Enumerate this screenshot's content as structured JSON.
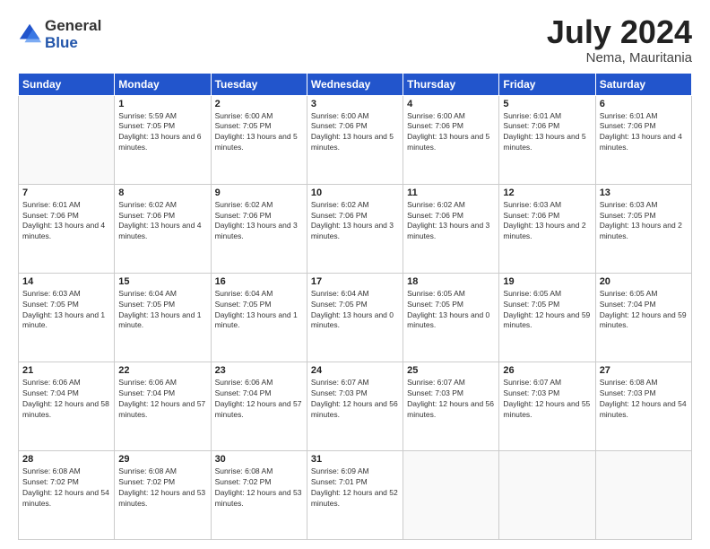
{
  "logo": {
    "general": "General",
    "blue": "Blue"
  },
  "title": {
    "month_year": "July 2024",
    "location": "Nema, Mauritania"
  },
  "header_days": [
    "Sunday",
    "Monday",
    "Tuesday",
    "Wednesday",
    "Thursday",
    "Friday",
    "Saturday"
  ],
  "weeks": [
    [
      {
        "day": "",
        "sunrise": "",
        "sunset": "",
        "daylight": ""
      },
      {
        "day": "1",
        "sunrise": "Sunrise: 5:59 AM",
        "sunset": "Sunset: 7:05 PM",
        "daylight": "Daylight: 13 hours and 6 minutes."
      },
      {
        "day": "2",
        "sunrise": "Sunrise: 6:00 AM",
        "sunset": "Sunset: 7:05 PM",
        "daylight": "Daylight: 13 hours and 5 minutes."
      },
      {
        "day": "3",
        "sunrise": "Sunrise: 6:00 AM",
        "sunset": "Sunset: 7:06 PM",
        "daylight": "Daylight: 13 hours and 5 minutes."
      },
      {
        "day": "4",
        "sunrise": "Sunrise: 6:00 AM",
        "sunset": "Sunset: 7:06 PM",
        "daylight": "Daylight: 13 hours and 5 minutes."
      },
      {
        "day": "5",
        "sunrise": "Sunrise: 6:01 AM",
        "sunset": "Sunset: 7:06 PM",
        "daylight": "Daylight: 13 hours and 5 minutes."
      },
      {
        "day": "6",
        "sunrise": "Sunrise: 6:01 AM",
        "sunset": "Sunset: 7:06 PM",
        "daylight": "Daylight: 13 hours and 4 minutes."
      }
    ],
    [
      {
        "day": "7",
        "sunrise": "Sunrise: 6:01 AM",
        "sunset": "Sunset: 7:06 PM",
        "daylight": "Daylight: 13 hours and 4 minutes."
      },
      {
        "day": "8",
        "sunrise": "Sunrise: 6:02 AM",
        "sunset": "Sunset: 7:06 PM",
        "daylight": "Daylight: 13 hours and 4 minutes."
      },
      {
        "day": "9",
        "sunrise": "Sunrise: 6:02 AM",
        "sunset": "Sunset: 7:06 PM",
        "daylight": "Daylight: 13 hours and 3 minutes."
      },
      {
        "day": "10",
        "sunrise": "Sunrise: 6:02 AM",
        "sunset": "Sunset: 7:06 PM",
        "daylight": "Daylight: 13 hours and 3 minutes."
      },
      {
        "day": "11",
        "sunrise": "Sunrise: 6:02 AM",
        "sunset": "Sunset: 7:06 PM",
        "daylight": "Daylight: 13 hours and 3 minutes."
      },
      {
        "day": "12",
        "sunrise": "Sunrise: 6:03 AM",
        "sunset": "Sunset: 7:06 PM",
        "daylight": "Daylight: 13 hours and 2 minutes."
      },
      {
        "day": "13",
        "sunrise": "Sunrise: 6:03 AM",
        "sunset": "Sunset: 7:05 PM",
        "daylight": "Daylight: 13 hours and 2 minutes."
      }
    ],
    [
      {
        "day": "14",
        "sunrise": "Sunrise: 6:03 AM",
        "sunset": "Sunset: 7:05 PM",
        "daylight": "Daylight: 13 hours and 1 minute."
      },
      {
        "day": "15",
        "sunrise": "Sunrise: 6:04 AM",
        "sunset": "Sunset: 7:05 PM",
        "daylight": "Daylight: 13 hours and 1 minute."
      },
      {
        "day": "16",
        "sunrise": "Sunrise: 6:04 AM",
        "sunset": "Sunset: 7:05 PM",
        "daylight": "Daylight: 13 hours and 1 minute."
      },
      {
        "day": "17",
        "sunrise": "Sunrise: 6:04 AM",
        "sunset": "Sunset: 7:05 PM",
        "daylight": "Daylight: 13 hours and 0 minutes."
      },
      {
        "day": "18",
        "sunrise": "Sunrise: 6:05 AM",
        "sunset": "Sunset: 7:05 PM",
        "daylight": "Daylight: 13 hours and 0 minutes."
      },
      {
        "day": "19",
        "sunrise": "Sunrise: 6:05 AM",
        "sunset": "Sunset: 7:05 PM",
        "daylight": "Daylight: 12 hours and 59 minutes."
      },
      {
        "day": "20",
        "sunrise": "Sunrise: 6:05 AM",
        "sunset": "Sunset: 7:04 PM",
        "daylight": "Daylight: 12 hours and 59 minutes."
      }
    ],
    [
      {
        "day": "21",
        "sunrise": "Sunrise: 6:06 AM",
        "sunset": "Sunset: 7:04 PM",
        "daylight": "Daylight: 12 hours and 58 minutes."
      },
      {
        "day": "22",
        "sunrise": "Sunrise: 6:06 AM",
        "sunset": "Sunset: 7:04 PM",
        "daylight": "Daylight: 12 hours and 57 minutes."
      },
      {
        "day": "23",
        "sunrise": "Sunrise: 6:06 AM",
        "sunset": "Sunset: 7:04 PM",
        "daylight": "Daylight: 12 hours and 57 minutes."
      },
      {
        "day": "24",
        "sunrise": "Sunrise: 6:07 AM",
        "sunset": "Sunset: 7:03 PM",
        "daylight": "Daylight: 12 hours and 56 minutes."
      },
      {
        "day": "25",
        "sunrise": "Sunrise: 6:07 AM",
        "sunset": "Sunset: 7:03 PM",
        "daylight": "Daylight: 12 hours and 56 minutes."
      },
      {
        "day": "26",
        "sunrise": "Sunrise: 6:07 AM",
        "sunset": "Sunset: 7:03 PM",
        "daylight": "Daylight: 12 hours and 55 minutes."
      },
      {
        "day": "27",
        "sunrise": "Sunrise: 6:08 AM",
        "sunset": "Sunset: 7:03 PM",
        "daylight": "Daylight: 12 hours and 54 minutes."
      }
    ],
    [
      {
        "day": "28",
        "sunrise": "Sunrise: 6:08 AM",
        "sunset": "Sunset: 7:02 PM",
        "daylight": "Daylight: 12 hours and 54 minutes."
      },
      {
        "day": "29",
        "sunrise": "Sunrise: 6:08 AM",
        "sunset": "Sunset: 7:02 PM",
        "daylight": "Daylight: 12 hours and 53 minutes."
      },
      {
        "day": "30",
        "sunrise": "Sunrise: 6:08 AM",
        "sunset": "Sunset: 7:02 PM",
        "daylight": "Daylight: 12 hours and 53 minutes."
      },
      {
        "day": "31",
        "sunrise": "Sunrise: 6:09 AM",
        "sunset": "Sunset: 7:01 PM",
        "daylight": "Daylight: 12 hours and 52 minutes."
      },
      {
        "day": "",
        "sunrise": "",
        "sunset": "",
        "daylight": ""
      },
      {
        "day": "",
        "sunrise": "",
        "sunset": "",
        "daylight": ""
      },
      {
        "day": "",
        "sunrise": "",
        "sunset": "",
        "daylight": ""
      }
    ]
  ]
}
